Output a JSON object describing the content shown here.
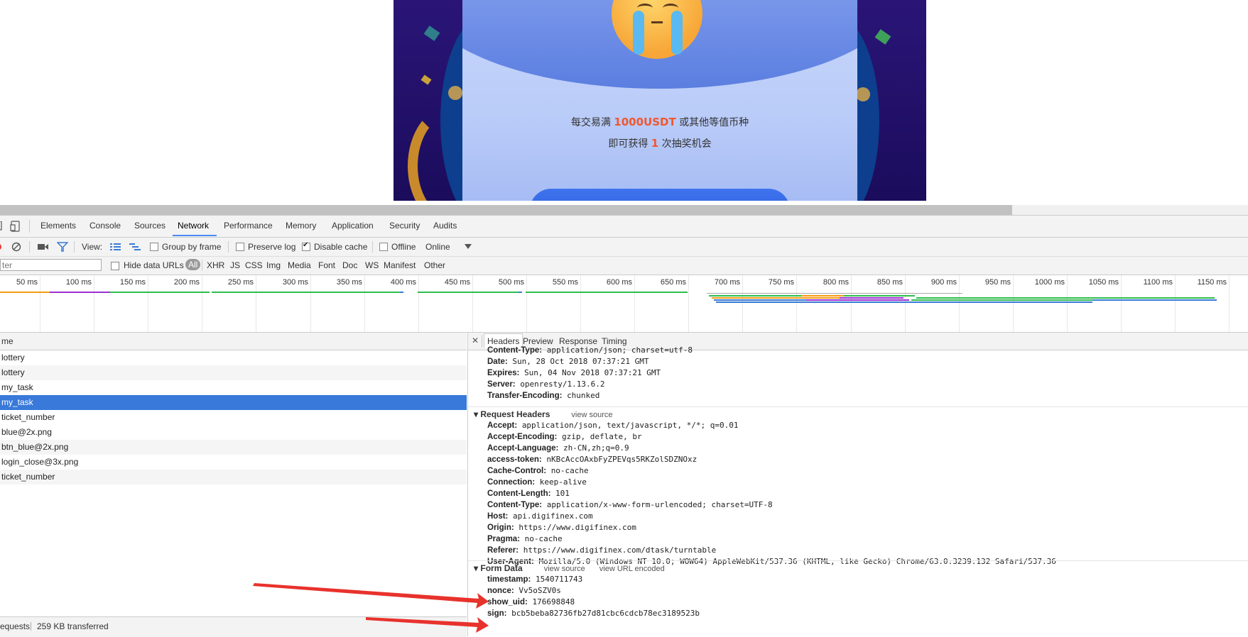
{
  "promo": {
    "line1_pre": "每交易满 ",
    "line1_highlight": "1000USDT",
    "line1_post": " 或其他等值币种",
    "line2_pre": "即可获得 ",
    "line2_highlight": "1",
    "line2_post": " 次抽奖机会",
    "highlight_color": "#f0572e"
  },
  "devtools": {
    "tabs": [
      "Elements",
      "Console",
      "Sources",
      "Network",
      "Performance",
      "Memory",
      "Application",
      "Security",
      "Audits"
    ],
    "active_tab": "Network",
    "toolbar": {
      "view_label": "View:",
      "group_by_frame": "Group by frame",
      "preserve_log": "Preserve log",
      "disable_cache": "Disable cache",
      "disable_cache_checked": true,
      "offline": "Offline",
      "throttle_value": "Online"
    },
    "filter": {
      "placeholder": "ter",
      "hide_data_urls": "Hide data URLs",
      "types": [
        "All",
        "XHR",
        "JS",
        "CSS",
        "Img",
        "Media",
        "Font",
        "Doc",
        "WS",
        "Manifest",
        "Other"
      ],
      "active_type": "All"
    },
    "timeline": {
      "ticks": [
        "50 ms",
        "100 ms",
        "150 ms",
        "200 ms",
        "250 ms",
        "300 ms",
        "350 ms",
        "400 ms",
        "450 ms",
        "500 ms",
        "550 ms",
        "600 ms",
        "650 ms",
        "700 ms",
        "750 ms",
        "800 ms",
        "850 ms",
        "900 ms",
        "950 ms",
        "1000 ms",
        "1050 ms",
        "1100 ms",
        "1150 ms"
      ]
    },
    "requests": {
      "column_header": "me",
      "rows": [
        "lottery",
        "lottery",
        "my_task",
        "my_task",
        "ticket_number",
        "blue@2x.png",
        "btn_blue@2x.png",
        "login_close@3x.png",
        "ticket_number"
      ],
      "selected_index": 3,
      "status": "equests",
      "transferred": "259 KB transferred"
    },
    "detail": {
      "close": "✕",
      "tabs": [
        "Headers",
        "Preview",
        "Response",
        "Timing"
      ],
      "active_tab": "Headers",
      "response_headers": [
        {
          "k": "Content-Type:",
          "v": "application/json; charset=utf-8"
        },
        {
          "k": "Date:",
          "v": "Sun, 28 Oct 2018 07:37:21 GMT"
        },
        {
          "k": "Expires:",
          "v": "Sun, 04 Nov 2018 07:37:21 GMT"
        },
        {
          "k": "Server:",
          "v": "openresty/1.13.6.2"
        },
        {
          "k": "Transfer-Encoding:",
          "v": "chunked"
        }
      ],
      "request_headers_title": "Request Headers",
      "request_headers_link": "view source",
      "request_headers": [
        {
          "k": "Accept:",
          "v": "application/json, text/javascript, */*; q=0.01"
        },
        {
          "k": "Accept-Encoding:",
          "v": "gzip, deflate, br"
        },
        {
          "k": "Accept-Language:",
          "v": "zh-CN,zh;q=0.9"
        },
        {
          "k": "access-token:",
          "v": "nKBcAccOAxbFyZPEVqs5RKZolSDZNOxz"
        },
        {
          "k": "Cache-Control:",
          "v": "no-cache"
        },
        {
          "k": "Connection:",
          "v": "keep-alive"
        },
        {
          "k": "Content-Length:",
          "v": "101"
        },
        {
          "k": "Content-Type:",
          "v": "application/x-www-form-urlencoded; charset=UTF-8"
        },
        {
          "k": "Host:",
          "v": "api.digifinex.com"
        },
        {
          "k": "Origin:",
          "v": "https://www.digifinex.com"
        },
        {
          "k": "Pragma:",
          "v": "no-cache"
        },
        {
          "k": "Referer:",
          "v": "https://www.digifinex.com/dtask/turntable"
        },
        {
          "k": "User-Agent:",
          "v": "Mozilla/5.0 (Windows NT 10.0; WOW64) AppleWebKit/537.36 (KHTML, like Gecko) Chrome/63.0.3239.132 Safari/537.36"
        }
      ],
      "form_data_title": "Form Data",
      "form_data_link1": "view source",
      "form_data_link2": "view URL encoded",
      "form_data": [
        {
          "k": "timestamp:",
          "v": "1540711743"
        },
        {
          "k": "nonce:",
          "v": "Vv5oSZV0s"
        },
        {
          "k": "show_uid:",
          "v": "176698848"
        },
        {
          "k": "sign:",
          "v": "bcb5beba82736fb27d81cbc6cdcb78ec3189523b"
        }
      ]
    }
  },
  "colors": {
    "accent": "#4a8af4",
    "selected_row": "#3879d9",
    "arrow": "#e8322c"
  }
}
